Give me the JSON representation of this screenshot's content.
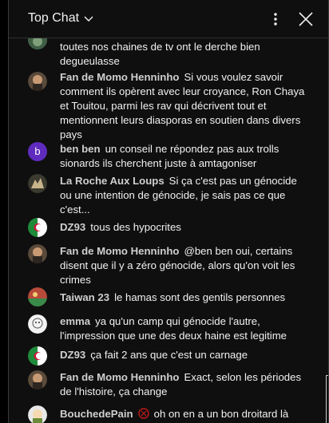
{
  "header": {
    "title": "Top Chat"
  },
  "messages": [
    {
      "author": "",
      "text": "toutes nos chaines de tv ont le derche bien degueulasse"
    },
    {
      "author": "Fan de Momo Henninho",
      "text": "Si vous voulez savoir comment ils opèrent avec leur croyance, Ron Chaya et Touitou, parmi les rav qui décrivent tout et mentionnent leurs diasporas en soutien dans divers pays"
    },
    {
      "author": "ben ben",
      "text": "un conseil ne répondez pas aux trolls sionards ils cherchent juste à amtagoniser",
      "avatar_letter": "b"
    },
    {
      "author": "La Roche Aux Loups",
      "text": "Si ça c'est pas un génocide ou une intention de génocide, je sais pas ce que c'est..."
    },
    {
      "author": "DZ93",
      "text": "tous des hypocrites"
    },
    {
      "author": "Fan de Momo Henninho",
      "text": "@ben ben oui, certains disent que il y a zéro génocide, alors qu'on voit les crimes"
    },
    {
      "author": "Taiwan 23",
      "text": "le hamas sont des gentils personnes"
    },
    {
      "author": "emma",
      "text": "ya qu'un camp qui génocide l'autre, l'impression que une des deux haine est legitime"
    },
    {
      "author": "DZ93",
      "text": "ça fait 2 ans que c'est un carnage"
    },
    {
      "author": "Fan de Momo Henninho",
      "text": "Exact, selon les périodes de l'histoire, ça change"
    },
    {
      "author": "BouchedePain",
      "text": "oh on en a un bon droitard là"
    }
  ],
  "colors": {
    "background": "#0f0f0f",
    "author": "#cfcfcf",
    "text": "#f1f1f1",
    "avatar_purple": "#5f2bbf"
  },
  "icons": [
    "chevron-down-icon",
    "more-vert-icon",
    "close-icon"
  ]
}
